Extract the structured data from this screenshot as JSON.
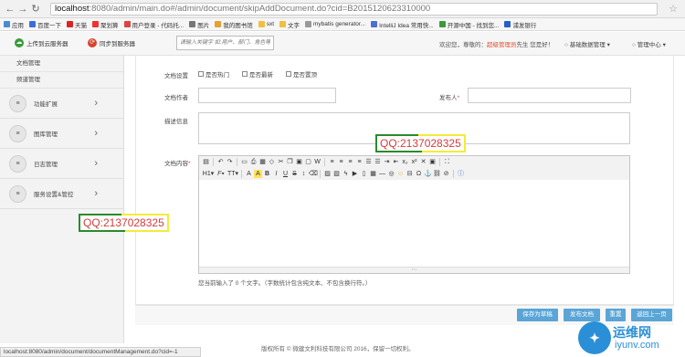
{
  "browser": {
    "url_host": "localhost",
    "url_rest": ":8080/admin/main.do#/admin/document/skipAddDocument.do?cid=B2015120623310000",
    "bookmarks": [
      "应用",
      "百度一下",
      "天猫",
      "聚划算",
      "用户登录 - 代码托...",
      "图片",
      "我的图书馆",
      "sxt",
      "文字",
      "mybatis generator...",
      "IntelliJ Idea 常用快...",
      "开源中国 - 找到您...",
      "浦发银行"
    ]
  },
  "header": {
    "upload_cloud_label": "上传到云服务器",
    "sync_label": "同步到服务器",
    "search_placeholder": "请输入关键字 如:用户、部门、角色等",
    "welcome_prefix": "欢迎您，尊敬的：",
    "welcome_role": "超级管理员",
    "welcome_suffix": "先生 您是好！",
    "menu_basic": "基础数据管理",
    "menu_admin": "管理中心"
  },
  "sidebar": {
    "sub_items": [
      "文档管理",
      "频道管理"
    ],
    "items": [
      {
        "label": "功能扩展",
        "icon": "list-icon"
      },
      {
        "label": "图库管理",
        "icon": "list-icon"
      },
      {
        "label": "日志管理",
        "icon": "list-icon"
      },
      {
        "label": "服务设置&管控",
        "icon": "list-icon"
      }
    ]
  },
  "form": {
    "doc_settings_label": "文档设置",
    "checkbox_hot": "是否热门",
    "checkbox_latest": "是否最新",
    "checkbox_top": "是否置顶",
    "author_label": "文档作者",
    "publisher_label": "发布人",
    "required_mark": "*",
    "desc_label": "描述信息",
    "content_label": "文档内容",
    "word_count": "您当前输入了 0 个文字。（字数统计包含纯文本、不包含换行符。）"
  },
  "buttons": {
    "save_draft": "保存为草稿",
    "publish": "发布文档",
    "reset": "重置",
    "back": "返回上一页"
  },
  "overlays": {
    "qq_label": "QQ:2137028325"
  },
  "status_bar": "localhost:8080/admin/document/documentManagement.do?cid=-1",
  "footer": "版权所有 © 微建文利科技有限公司 2016，保留一切权利。",
  "watermark": {
    "title": "运维网",
    "url": "iyunv.com"
  },
  "colors": {
    "accent": "#5aa5d6",
    "required": "#e04c2c",
    "qq_text": "#d63b3b"
  }
}
